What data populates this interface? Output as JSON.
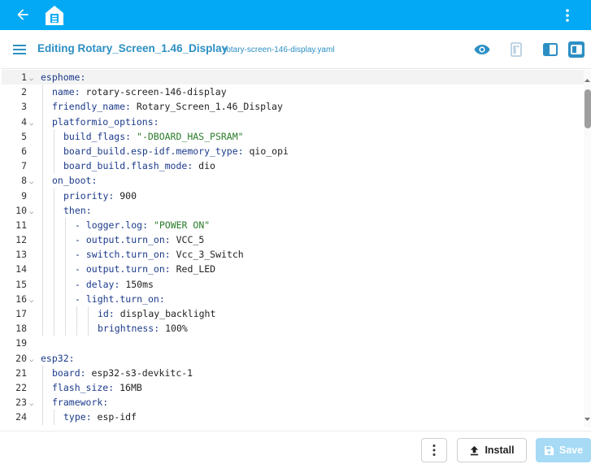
{
  "appbar": {
    "back_icon": "arrow-left-icon",
    "logo_icon": "esphome-logo-icon",
    "menu_icon": "more-vertical-icon",
    "color": "#03a9f4"
  },
  "editor_header": {
    "title": "Editing Rotary_Screen_1.46_Display",
    "filename": "rotary-screen-146-display.yaml",
    "accent": "#2c8fc4"
  },
  "code": {
    "active_line": 1,
    "lines": [
      {
        "n": "1",
        "fold": true,
        "indent": 0,
        "key": "esphome:",
        "val": "",
        "valtype": ""
      },
      {
        "n": "2",
        "fold": false,
        "indent": 1,
        "key": "name:",
        "val": " rotary-screen-146-display",
        "valtype": "plain"
      },
      {
        "n": "3",
        "fold": false,
        "indent": 1,
        "key": "friendly_name:",
        "val": " Rotary_Screen_1.46_Display",
        "valtype": "plain"
      },
      {
        "n": "4",
        "fold": true,
        "indent": 1,
        "key": "platformio_options:",
        "val": "",
        "valtype": ""
      },
      {
        "n": "5",
        "fold": false,
        "indent": 2,
        "key": "build_flags:",
        "val": " \"-DBOARD_HAS_PSRAM\"",
        "valtype": "str"
      },
      {
        "n": "6",
        "fold": false,
        "indent": 2,
        "key": "board_build.esp-idf.memory_type:",
        "val": " qio_opi",
        "valtype": "plain"
      },
      {
        "n": "7",
        "fold": false,
        "indent": 2,
        "key": "board_build.flash_mode:",
        "val": " dio",
        "valtype": "plain"
      },
      {
        "n": "8",
        "fold": true,
        "indent": 1,
        "key": "on_boot:",
        "val": "",
        "valtype": ""
      },
      {
        "n": "9",
        "fold": false,
        "indent": 2,
        "key": "priority:",
        "val": " 900",
        "valtype": "plain"
      },
      {
        "n": "10",
        "fold": true,
        "indent": 2,
        "key": "then:",
        "val": "",
        "valtype": ""
      },
      {
        "n": "11",
        "fold": false,
        "indent": 3,
        "key": "- logger.log:",
        "val": " \"POWER ON\"",
        "valtype": "str"
      },
      {
        "n": "12",
        "fold": false,
        "indent": 3,
        "key": "- output.turn_on:",
        "val": " VCC_5",
        "valtype": "plain"
      },
      {
        "n": "13",
        "fold": false,
        "indent": 3,
        "key": "- switch.turn_on:",
        "val": " Vcc_3_Switch",
        "valtype": "plain"
      },
      {
        "n": "14",
        "fold": false,
        "indent": 3,
        "key": "- output.turn_on:",
        "val": " Red_LED",
        "valtype": "plain"
      },
      {
        "n": "15",
        "fold": false,
        "indent": 3,
        "key": "- delay:",
        "val": " 150ms",
        "valtype": "plain"
      },
      {
        "n": "16",
        "fold": true,
        "indent": 3,
        "key": "- light.turn_on:",
        "val": "",
        "valtype": ""
      },
      {
        "n": "17",
        "fold": false,
        "indent": 5,
        "key": "id:",
        "val": " display_backlight",
        "valtype": "plain"
      },
      {
        "n": "18",
        "fold": false,
        "indent": 5,
        "key": "brightness:",
        "val": " 100%",
        "valtype": "plain"
      },
      {
        "n": "19",
        "fold": false,
        "indent": 0,
        "key": "",
        "val": "",
        "valtype": ""
      },
      {
        "n": "20",
        "fold": true,
        "indent": 0,
        "key": "esp32:",
        "val": "",
        "valtype": ""
      },
      {
        "n": "21",
        "fold": false,
        "indent": 1,
        "key": "board:",
        "val": " esp32-s3-devkitc-1",
        "valtype": "plain"
      },
      {
        "n": "22",
        "fold": false,
        "indent": 1,
        "key": "flash_size:",
        "val": " 16MB",
        "valtype": "plain"
      },
      {
        "n": "23",
        "fold": true,
        "indent": 1,
        "key": "framework:",
        "val": "",
        "valtype": ""
      },
      {
        "n": "24",
        "fold": false,
        "indent": 2,
        "key": "type:",
        "val": " esp-idf",
        "valtype": "plain"
      }
    ]
  },
  "actions": {
    "more_icon": "more-vertical-icon",
    "install_label": "Install",
    "save_label": "Save"
  }
}
